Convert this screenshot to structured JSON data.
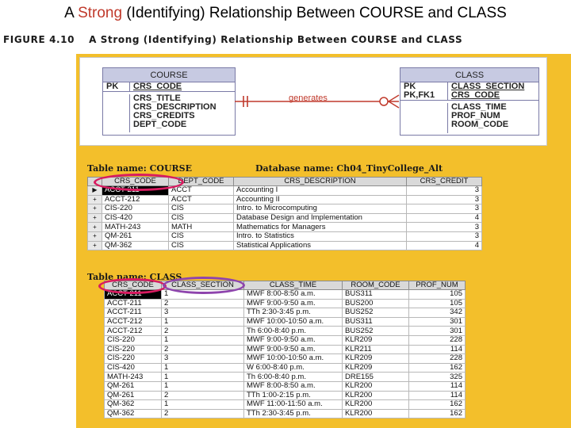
{
  "slide": {
    "title_pre": "A ",
    "title_accent": "Strong",
    "title_post": " (Identifying) Relationship Between COURSE and CLASS",
    "accent_color": "#c0392b"
  },
  "figure": {
    "number": "FIGURE 4.10",
    "caption": "A Strong (Identifying) Relationship Between COURSE and CLASS"
  },
  "erd": {
    "course": {
      "name": "COURSE",
      "pk_label": "PK",
      "pk_attr": "CRS_CODE",
      "attrs": [
        "CRS_TITLE",
        "CRS_DESCRIPTION",
        "CRS_CREDITS",
        "DEPT_CODE"
      ]
    },
    "class": {
      "name": "CLASS",
      "pk_labels": [
        "PK",
        "PK,FK1"
      ],
      "pk_attrs": [
        "CLASS_SECTION",
        "CRS_CODE"
      ],
      "attrs": [
        "CLASS_TIME",
        "PROF_NUM",
        "ROOM_CODE"
      ]
    },
    "relationship": "generates",
    "relationship_color": "#c0392b"
  },
  "course_table": {
    "caption": "Table name: COURSE",
    "db_caption": "Database name: Ch04_TinyCollege_Alt",
    "columns": [
      "CRS_CODE",
      "DEPT_CODE",
      "CRS_DESCRIPTION",
      "CRS_CREDIT"
    ],
    "rows": [
      [
        "ACCT-211",
        "ACCT",
        "Accounting I",
        "3"
      ],
      [
        "ACCT-212",
        "ACCT",
        "Accounting II",
        "3"
      ],
      [
        "CIS-220",
        "CIS",
        "Intro. to Microcomputing",
        "3"
      ],
      [
        "CIS-420",
        "CIS",
        "Database Design and Implementation",
        "4"
      ],
      [
        "MATH-243",
        "MATH",
        "Mathematics for Managers",
        "3"
      ],
      [
        "QM-261",
        "CIS",
        "Intro. to Statistics",
        "3"
      ],
      [
        "QM-362",
        "CIS",
        "Statistical Applications",
        "4"
      ]
    ],
    "row_marker": "+",
    "active_marker": "▶",
    "highlight_color": "#d81b60"
  },
  "class_table": {
    "caption": "Table name: CLASS",
    "columns": [
      "CRS_CODE",
      "CLASS_SECTION",
      "CLASS_TIME",
      "ROOM_CODE",
      "PROF_NUM"
    ],
    "rows": [
      [
        "ACCT-211",
        "1",
        "MWF 8:00-8:50 a.m.",
        "BUS311",
        "105"
      ],
      [
        "ACCT-211",
        "2",
        "MWF 9:00-9:50 a.m.",
        "BUS200",
        "105"
      ],
      [
        "ACCT-211",
        "3",
        "TTh 2:30-3:45 p.m.",
        "BUS252",
        "342"
      ],
      [
        "ACCT-212",
        "1",
        "MWF 10:00-10:50 a.m.",
        "BUS311",
        "301"
      ],
      [
        "ACCT-212",
        "2",
        "Th 6:00-8:40 p.m.",
        "BUS252",
        "301"
      ],
      [
        "CIS-220",
        "1",
        "MWF 9:00-9:50 a.m.",
        "KLR209",
        "228"
      ],
      [
        "CIS-220",
        "2",
        "MWF 9:00-9:50 a.m.",
        "KLR211",
        "114"
      ],
      [
        "CIS-220",
        "3",
        "MWF 10:00-10:50 a.m.",
        "KLR209",
        "228"
      ],
      [
        "CIS-420",
        "1",
        "W 6:00-8:40 p.m.",
        "KLR209",
        "162"
      ],
      [
        "MATH-243",
        "1",
        "Th 6:00-8:40 p.m.",
        "DRE155",
        "325"
      ],
      [
        "QM-261",
        "1",
        "MWF 8:00-8:50 a.m.",
        "KLR200",
        "114"
      ],
      [
        "QM-261",
        "2",
        "TTh 1:00-2:15 p.m.",
        "KLR200",
        "114"
      ],
      [
        "QM-362",
        "1",
        "MWF 11:00-11:50 a.m.",
        "KLR200",
        "162"
      ],
      [
        "QM-362",
        "2",
        "TTh 2:30-3:45 p.m.",
        "KLR200",
        "162"
      ]
    ],
    "highlight_color_1": "#d81b60",
    "highlight_color_2": "#8e44ad"
  }
}
